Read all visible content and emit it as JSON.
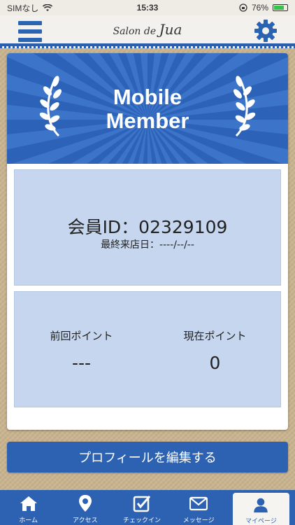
{
  "status_bar": {
    "carrier": "SIMなし",
    "time": "15:33",
    "battery": "76%"
  },
  "header": {
    "logo_small": "Salon de",
    "logo_big": "Jua"
  },
  "banner": {
    "line1": "Mobile",
    "line2": "Member"
  },
  "member": {
    "id_text": "会員ID：02329109",
    "last_visit": "最終来店日：----/--/--"
  },
  "points": {
    "previous_label": "前回ポイント",
    "previous_value": "---",
    "current_label": "現在ポイント",
    "current_value": "0"
  },
  "profile_button": "プロフィールを編集する",
  "tabs": [
    {
      "label": "ホーム",
      "icon": "home-icon"
    },
    {
      "label": "アクセス",
      "icon": "map-pin-icon"
    },
    {
      "label": "チェックイン",
      "icon": "checkbox-icon"
    },
    {
      "label": "メッセージ",
      "icon": "mail-icon"
    },
    {
      "label": "マイページ",
      "icon": "user-icon"
    }
  ],
  "colors": {
    "accent": "#2d62b3",
    "panel": "#c5d6ee",
    "background": "#c9b48f"
  }
}
